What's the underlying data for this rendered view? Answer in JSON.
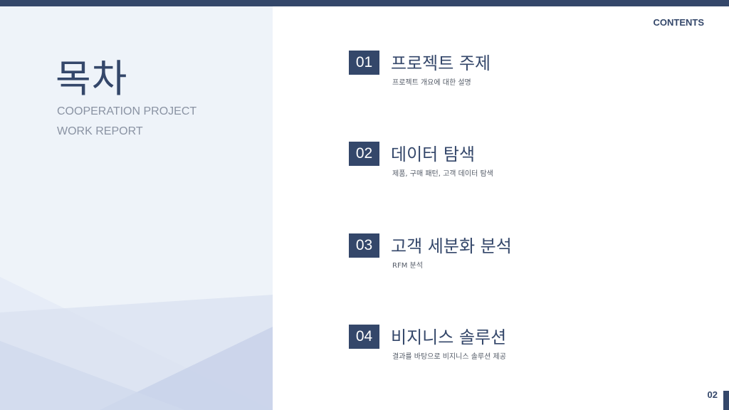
{
  "slide": {
    "title": "목차",
    "subtitle_line1": "COOPERATION PROJECT",
    "subtitle_line2": "WORK REPORT",
    "contents_label": "CONTENTS",
    "page_number": "02"
  },
  "items": [
    {
      "number": "01",
      "title": "프로젝트 주제",
      "description": "프로젝트 개요에 대한 설명"
    },
    {
      "number": "02",
      "title": "데이터 탐색",
      "description": "제품, 구매 패턴, 고객 데이터 탐색"
    },
    {
      "number": "03",
      "title": "고객 세분화 분석",
      "description": "RFM 분석"
    },
    {
      "number": "04",
      "title": "비지니스 솔루션",
      "description": "결과를 바탕으로 비지니스 솔루션 제공"
    }
  ],
  "colors": {
    "accent": "#34476a",
    "left_panel_bg": "#eef3f9",
    "subtitle": "#8a93a3"
  }
}
